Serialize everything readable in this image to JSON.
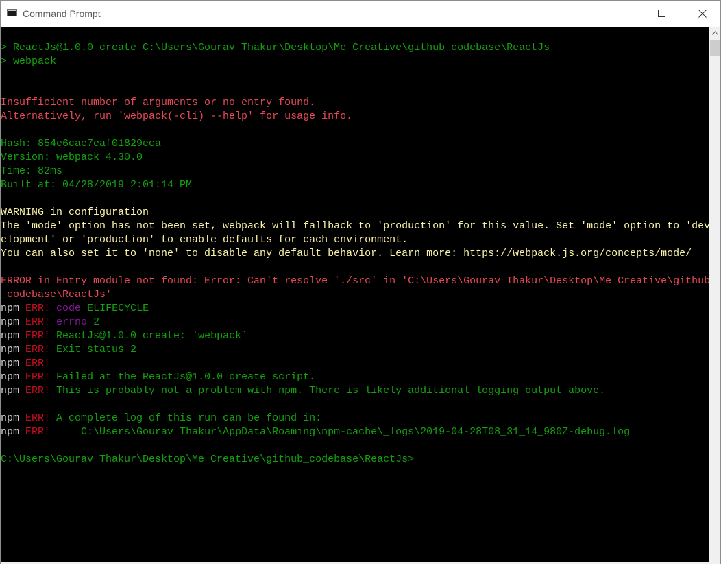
{
  "window": {
    "title": "Command Prompt"
  },
  "console": {
    "lines": [
      [
        {
          "t": "> ReactJs@1.0.0 create C:\\Users\\Gourav Thakur\\Desktop\\Me Creative\\github_codebase\\ReactJs",
          "c": "green"
        }
      ],
      [
        {
          "t": "> webpack",
          "c": "green"
        }
      ],
      [
        {
          "t": "",
          "c": "white"
        }
      ],
      [
        {
          "t": "",
          "c": "white"
        }
      ],
      [
        {
          "t": "Insufficient number of arguments or no entry found.",
          "c": "red"
        }
      ],
      [
        {
          "t": "Alternatively, run 'webpack(-cli) --help' for usage info.",
          "c": "red"
        }
      ],
      [
        {
          "t": "",
          "c": "white"
        }
      ],
      [
        {
          "t": "Hash: ",
          "c": "green"
        },
        {
          "t": "854e6cae7eaf01829eca",
          "c": "green"
        }
      ],
      [
        {
          "t": "Version: webpack ",
          "c": "green"
        },
        {
          "t": "4.30.0",
          "c": "green"
        }
      ],
      [
        {
          "t": "Time: ",
          "c": "green"
        },
        {
          "t": "82ms",
          "c": "green"
        }
      ],
      [
        {
          "t": "Built at: 04/28/2019 ",
          "c": "green"
        },
        {
          "t": "2:01:14 PM",
          "c": "green"
        }
      ],
      [
        {
          "t": "",
          "c": "white"
        }
      ],
      [
        {
          "t": "WARNING in configuration",
          "c": "yellow"
        }
      ],
      [
        {
          "t": "The 'mode' option has not been set, webpack will fallback to 'production' for this value. Set 'mode' option to 'dev",
          "c": "yellow"
        }
      ],
      [
        {
          "t": "elopment' or 'production' to enable defaults for each environment.",
          "c": "yellow"
        }
      ],
      [
        {
          "t": "You can also set it to 'none' to disable any default behavior. Learn more: https://webpack.js.org/concepts/mode/",
          "c": "yellow"
        }
      ],
      [
        {
          "t": "",
          "c": "white"
        }
      ],
      [
        {
          "t": "ERROR in Entry module not found: Error: Can't resolve './src' in 'C:\\Users\\Gourav Thakur\\Desktop\\Me Creative\\github",
          "c": "red"
        }
      ],
      [
        {
          "t": "_codebase\\ReactJs'",
          "c": "red"
        }
      ],
      [
        {
          "t": "npm ",
          "c": "white"
        },
        {
          "t": "ERR!",
          "c": "ferr"
        },
        {
          "t": " ",
          "c": "white"
        },
        {
          "t": "code",
          "c": "purple"
        },
        {
          "t": " ELIFECYCLE",
          "c": "green"
        }
      ],
      [
        {
          "t": "npm ",
          "c": "white"
        },
        {
          "t": "ERR!",
          "c": "ferr"
        },
        {
          "t": " ",
          "c": "white"
        },
        {
          "t": "errno",
          "c": "purple"
        },
        {
          "t": " 2",
          "c": "green"
        }
      ],
      [
        {
          "t": "npm ",
          "c": "white"
        },
        {
          "t": "ERR!",
          "c": "ferr"
        },
        {
          "t": " ReactJs@1.0.0 create: `webpack`",
          "c": "green"
        }
      ],
      [
        {
          "t": "npm ",
          "c": "white"
        },
        {
          "t": "ERR!",
          "c": "ferr"
        },
        {
          "t": " Exit status 2",
          "c": "green"
        }
      ],
      [
        {
          "t": "npm ",
          "c": "white"
        },
        {
          "t": "ERR!",
          "c": "ferr"
        }
      ],
      [
        {
          "t": "npm ",
          "c": "white"
        },
        {
          "t": "ERR!",
          "c": "ferr"
        },
        {
          "t": " Failed at the ReactJs@1.0.0 create script.",
          "c": "green"
        }
      ],
      [
        {
          "t": "npm ",
          "c": "white"
        },
        {
          "t": "ERR!",
          "c": "ferr"
        },
        {
          "t": " This is probably not a problem with npm. There is likely additional logging output above.",
          "c": "green"
        }
      ],
      [
        {
          "t": "",
          "c": "white"
        }
      ],
      [
        {
          "t": "npm ",
          "c": "white"
        },
        {
          "t": "ERR!",
          "c": "ferr"
        },
        {
          "t": " A complete log of this run can be found in:",
          "c": "green"
        }
      ],
      [
        {
          "t": "npm ",
          "c": "white"
        },
        {
          "t": "ERR!",
          "c": "ferr"
        },
        {
          "t": "     C:\\Users\\Gourav Thakur\\AppData\\Roaming\\npm-cache\\_logs\\2019-04-28T08_31_14_980Z-debug.log",
          "c": "green"
        }
      ],
      [
        {
          "t": "",
          "c": "white"
        }
      ],
      [
        {
          "t": "C:\\Users\\Gourav Thakur\\Desktop\\Me Creative\\github_codebase\\ReactJs>",
          "c": "green"
        }
      ]
    ]
  }
}
